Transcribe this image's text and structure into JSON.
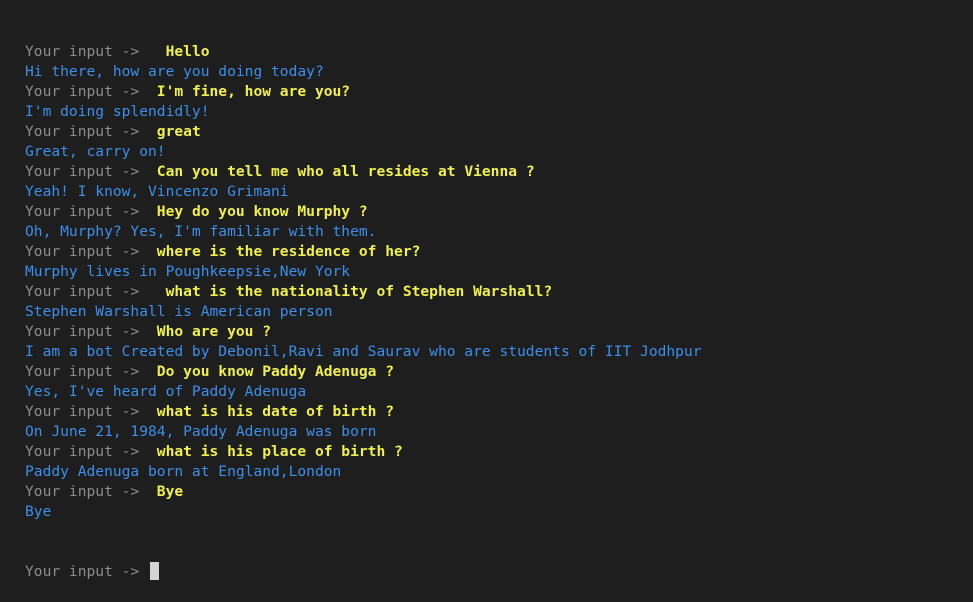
{
  "terminal": {
    "lines": [
      {
        "prompt": "Your input -> ",
        "input": "  Hello"
      },
      {
        "output": "Hi there, how are you doing today?"
      },
      {
        "prompt": "Your input -> ",
        "input": " I'm fine, how are you?"
      },
      {
        "output": "I'm doing splendidly!"
      },
      {
        "prompt": "Your input -> ",
        "input": " great"
      },
      {
        "output": "Great, carry on!"
      },
      {
        "prompt": "Your input -> ",
        "input": " Can you tell me who all resides at Vienna ?"
      },
      {
        "output": "Yeah! I know, Vincenzo Grimani"
      },
      {
        "prompt": "Your input -> ",
        "input": " Hey do you know Murphy ?"
      },
      {
        "output": "Oh, Murphy? Yes, I'm familiar with them."
      },
      {
        "prompt": "Your input -> ",
        "input": " where is the residence of her?"
      },
      {
        "output": "Murphy lives in Poughkeepsie,New York"
      },
      {
        "prompt": "Your input -> ",
        "input": "  what is the nationality of Stephen Warshall?"
      },
      {
        "output": "Stephen Warshall is American person"
      },
      {
        "prompt": "Your input -> ",
        "input": " Who are you ?"
      },
      {
        "output": "I am a bot Created by Debonil,Ravi and Saurav who are students of IIT Jodhpur"
      },
      {
        "prompt": "Your input -> ",
        "input": " Do you know Paddy Adenuga ?"
      },
      {
        "output": "Yes, I've heard of Paddy Adenuga"
      },
      {
        "prompt": "Your input -> ",
        "input": " what is his date of birth ?"
      },
      {
        "output": "On June 21, 1984, Paddy Adenuga was born"
      },
      {
        "prompt": "Your input -> ",
        "input": " what is his place of birth ?"
      },
      {
        "output": "Paddy Adenuga born at England,London"
      },
      {
        "prompt": "Your input -> ",
        "input": " Bye"
      },
      {
        "output": "Bye"
      }
    ],
    "current_prompt": "Your input -> "
  }
}
